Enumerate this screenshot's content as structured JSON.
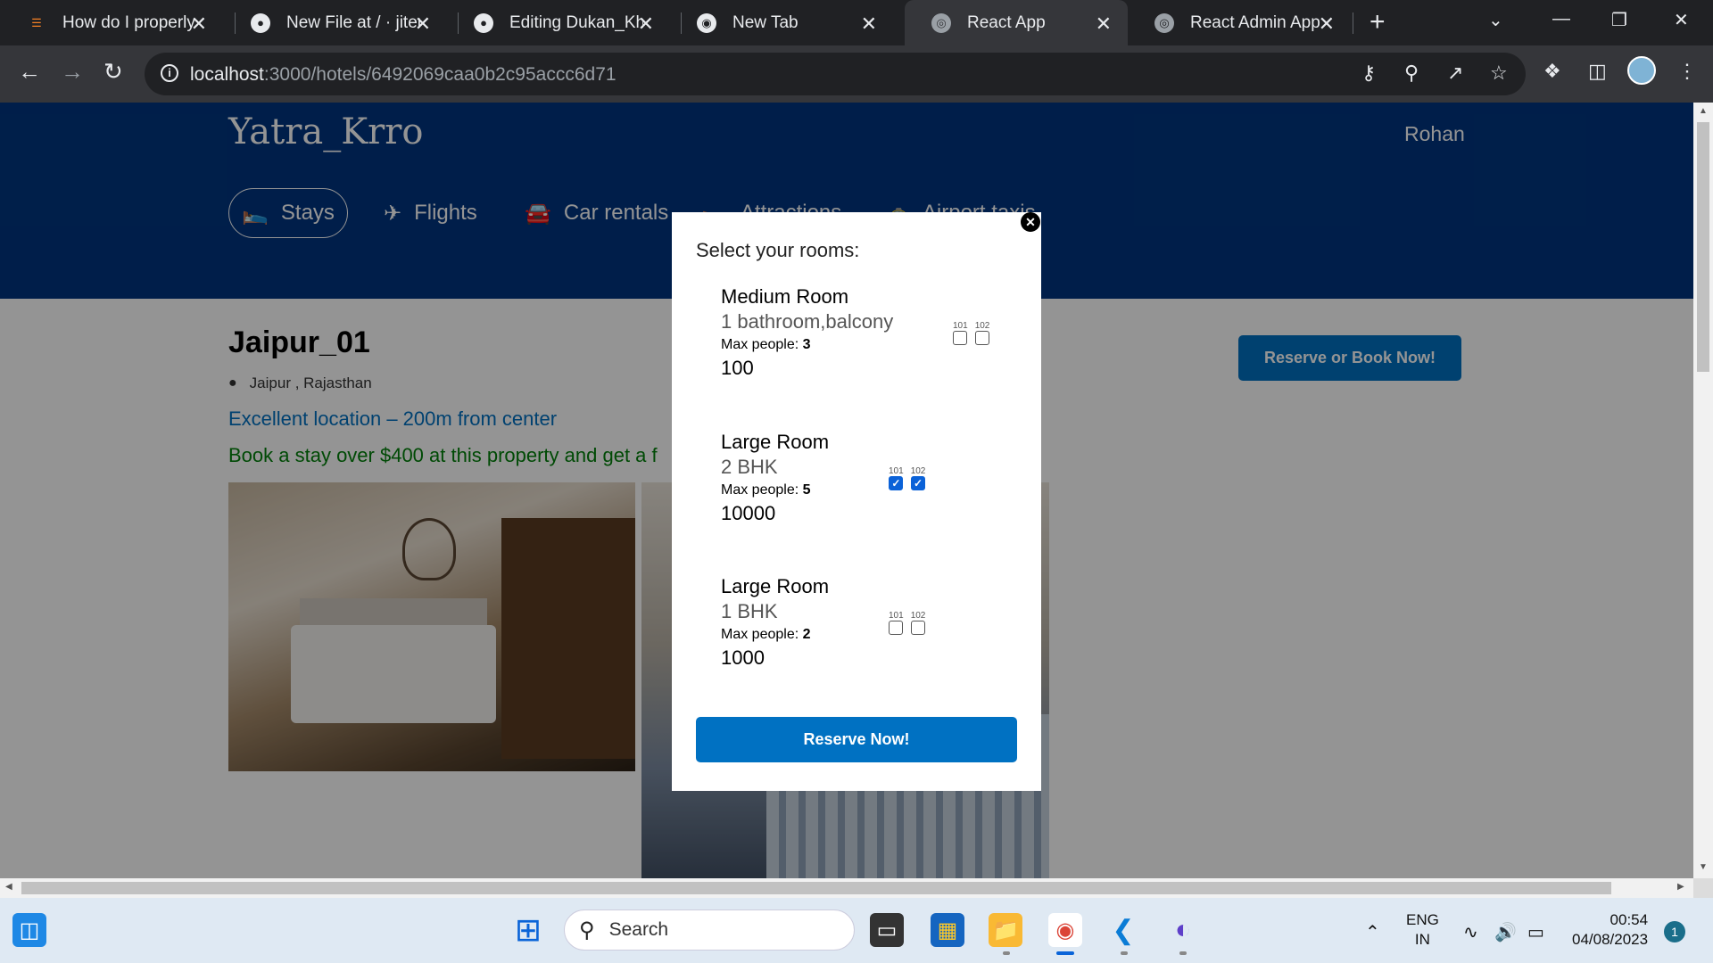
{
  "browser": {
    "tabs": [
      {
        "title": "How do I properly f",
        "icon": "stackoverflow-icon",
        "active": false
      },
      {
        "title": "New File at / · jitend",
        "icon": "github-icon",
        "active": false
      },
      {
        "title": "Editing Dukan_Khat",
        "icon": "github-icon",
        "active": false
      },
      {
        "title": "New Tab",
        "icon": "chrome-icon",
        "active": false
      },
      {
        "title": "React App",
        "icon": "globe-icon",
        "active": true
      },
      {
        "title": "React Admin App",
        "icon": "globe-icon",
        "active": false
      }
    ],
    "url_host": "localhost",
    "url_path": ":3000/hotels/6492069caa0b2c95accc6d71"
  },
  "site": {
    "logo": "Yatra_Krro",
    "user": "Rohan",
    "nav": [
      {
        "label": "Stays",
        "icon": "bed-icon",
        "active": true
      },
      {
        "label": "Flights",
        "icon": "plane-icon",
        "active": false
      },
      {
        "label": "Car rentals",
        "icon": "car-icon",
        "active": false
      },
      {
        "label": "Attractions",
        "icon": "bed-icon",
        "active": false
      },
      {
        "label": "Airport taxis",
        "icon": "taxi-icon",
        "active": false
      }
    ]
  },
  "hotel": {
    "name": "Jaipur_01",
    "address": "Jaipur , Rajasthan",
    "distance": "Excellent location – 200m from center",
    "highlight": "Book a stay over $400 at this property and get a f",
    "book_button": "Reserve or Book Now!"
  },
  "modal": {
    "title": "Select your rooms:",
    "rooms": [
      {
        "title": "Medium Room",
        "desc": "1 bathroom,balcony",
        "max_label": "Max people: ",
        "max": "3",
        "price": "100",
        "numbers": [
          {
            "label": "101",
            "checked": false
          },
          {
            "label": "102",
            "checked": false
          }
        ]
      },
      {
        "title": "Large Room",
        "desc": "2 BHK",
        "max_label": "Max people: ",
        "max": "5",
        "price": "10000",
        "numbers": [
          {
            "label": "101",
            "checked": true
          },
          {
            "label": "102",
            "checked": true
          }
        ]
      },
      {
        "title": "Large Room",
        "desc": "1 BHK",
        "max_label": "Max people: ",
        "max": "2",
        "price": "1000",
        "numbers": [
          {
            "label": "101",
            "checked": false
          },
          {
            "label": "102",
            "checked": false
          }
        ]
      }
    ],
    "reserve_button": "Reserve Now!"
  },
  "taskbar": {
    "search": "Search",
    "lang_top": "ENG",
    "lang_bottom": "IN",
    "time": "00:54",
    "date": "04/08/2023",
    "notifications": "1"
  },
  "colors": {
    "brand": "#003580",
    "accent": "#0071c2",
    "highlight": "#008009"
  }
}
